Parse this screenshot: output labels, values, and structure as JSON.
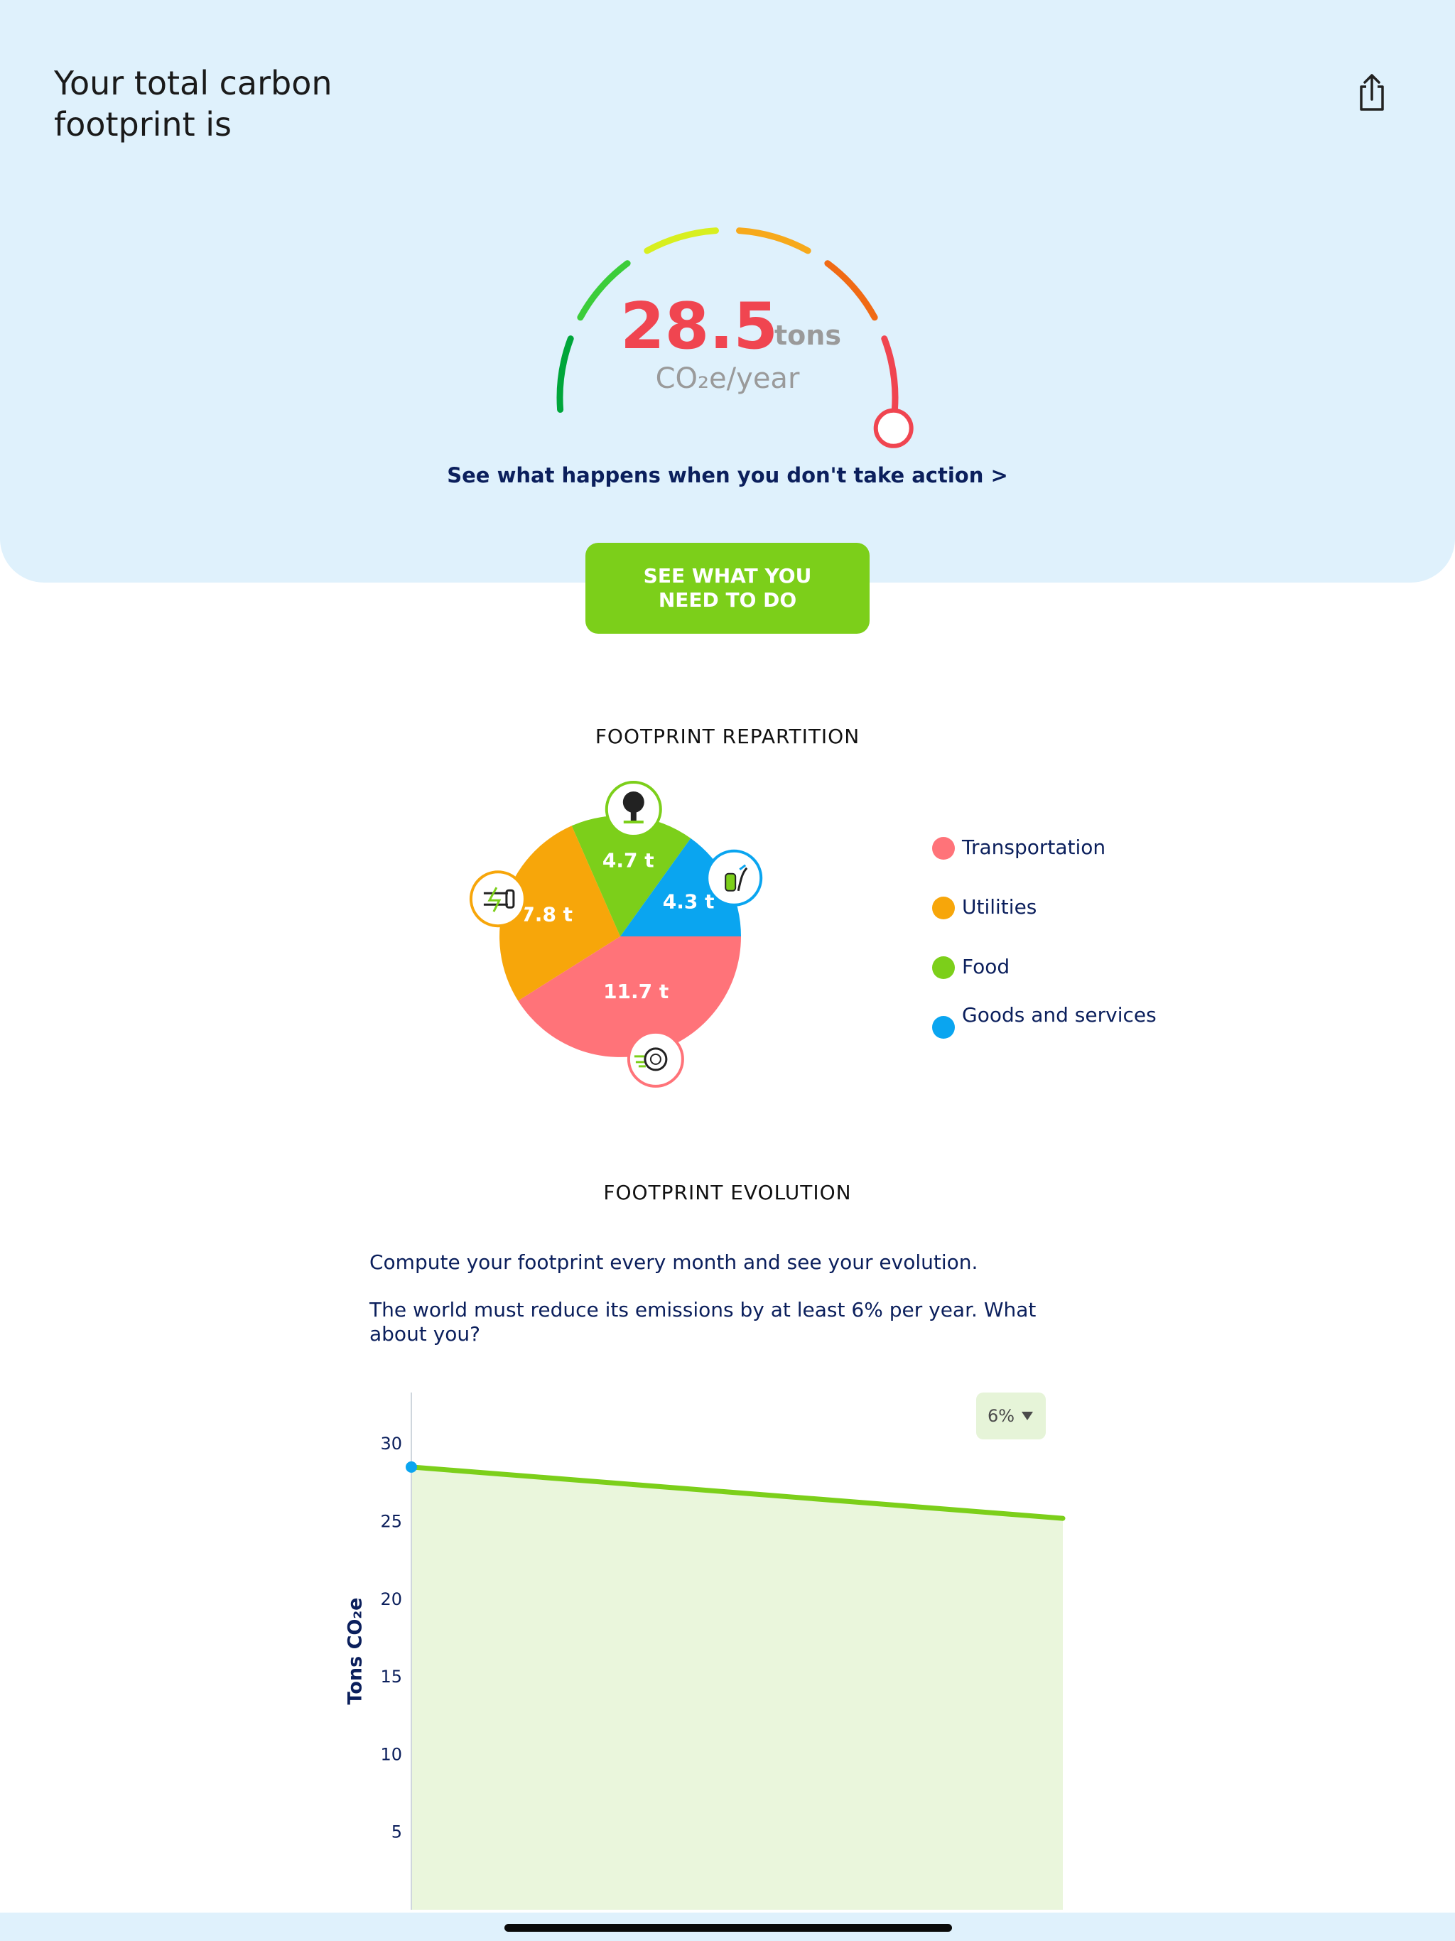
{
  "header": {
    "title": "Your total carbon footprint is"
  },
  "gauge": {
    "value": "28.5",
    "unit": "tons",
    "sub_unit": "CO₂e/year",
    "segment_colors": [
      "#00a63a",
      "#3ccd3a",
      "#d8ef1f",
      "#f7a91b",
      "#f06a14",
      "#f04550"
    ],
    "level": 1.0
  },
  "action_link": "See what happens when you don't take action >",
  "cta_button": "SEE WHAT YOU NEED TO DO",
  "repartition": {
    "title": "FOOTPRINT REPARTITION",
    "legend": [
      {
        "label": "Transportation",
        "color": "#ff7379"
      },
      {
        "label": "Utilities",
        "color": "#f7a60a"
      },
      {
        "label": "Food",
        "color": "#7ccf1a"
      },
      {
        "label": "Goods and services",
        "color": "#0aa5f0"
      }
    ],
    "slice_labels": [
      "11.7 t",
      "7.8 t",
      "4.7 t",
      "4.3 t"
    ],
    "icons": [
      "wheel-icon",
      "plug-icon",
      "tree-icon",
      "bottle-icon"
    ]
  },
  "evolution": {
    "title": "FOOTPRINT EVOLUTION",
    "text1": "Compute your footprint every month and see your evolution.",
    "text2": "The world must reduce its emissions by at least 6% per year. What about you?",
    "rate": "6%",
    "y_title": "Tons CO₂e",
    "y_ticks": [
      "30",
      "25",
      "20",
      "15",
      "10",
      "5"
    ]
  },
  "chart_data": {
    "type": "area",
    "title": "FOOTPRINT EVOLUTION",
    "xlabel": "",
    "ylabel": "Tons CO₂e",
    "ylim": [
      0,
      33.3
    ],
    "y_ticks": [
      5,
      10,
      15,
      20,
      25,
      30
    ],
    "series": [
      {
        "values": [
          28.5,
          25.2
        ],
        "color": "#7ccf1a"
      }
    ]
  },
  "pie_data": {
    "type": "pie",
    "categories": [
      "Transportation",
      "Utilities",
      "Food",
      "Goods and services"
    ],
    "values": [
      11.7,
      7.8,
      4.7,
      4.3
    ]
  }
}
